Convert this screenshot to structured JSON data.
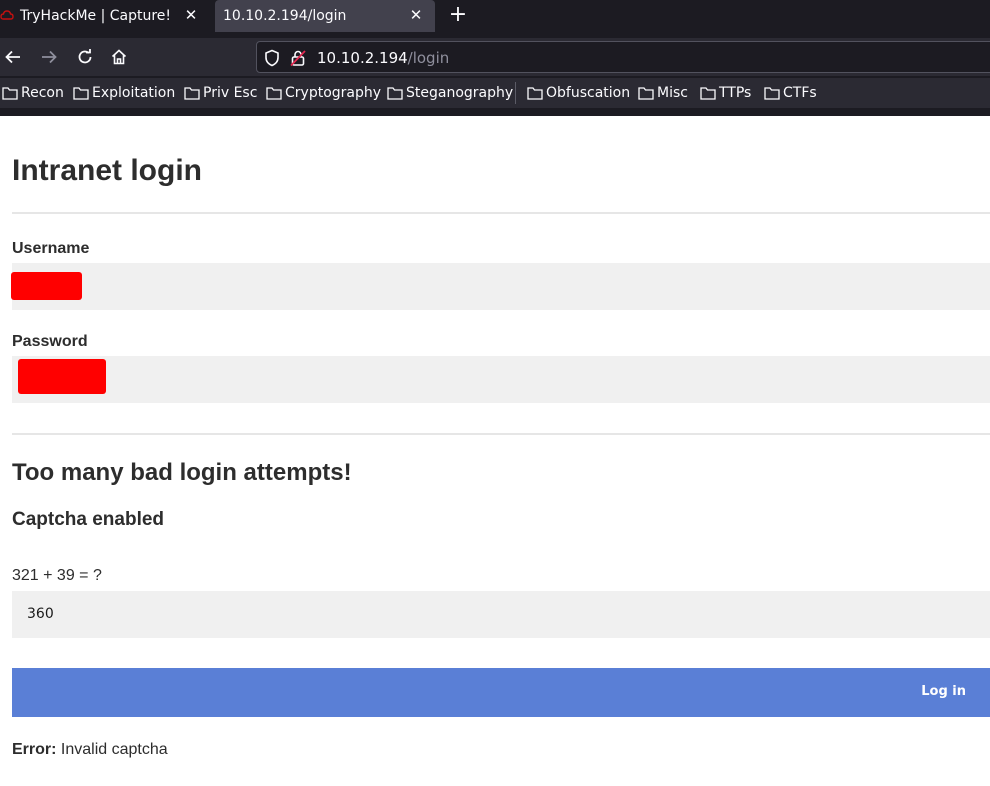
{
  "browser": {
    "tabs": [
      {
        "title": "TryHackMe | Capture!",
        "active": false
      },
      {
        "title": "10.10.2.194/login",
        "active": true
      }
    ],
    "url_host": "10.10.2.194",
    "url_path": "/login",
    "bookmarks": [
      "Recon",
      "Exploitation",
      "Priv Esc",
      "Cryptography",
      "Steganography",
      "Obfuscation",
      "Misc",
      "TTPs",
      "CTFs"
    ]
  },
  "page": {
    "title": "Intranet login",
    "username_label": "Username",
    "password_label": "Password",
    "warning": "Too many bad login attempts!",
    "captcha_heading": "Captcha enabled",
    "captcha_question": "321 + 39 = ?",
    "captcha_answer": "360",
    "login_button": "Log in",
    "error_label": "Error:",
    "error_message": " Invalid captcha"
  },
  "colors": {
    "redaction": "#ff0000",
    "button": "#5a7fd6",
    "input_bg": "#f0f0f0"
  }
}
